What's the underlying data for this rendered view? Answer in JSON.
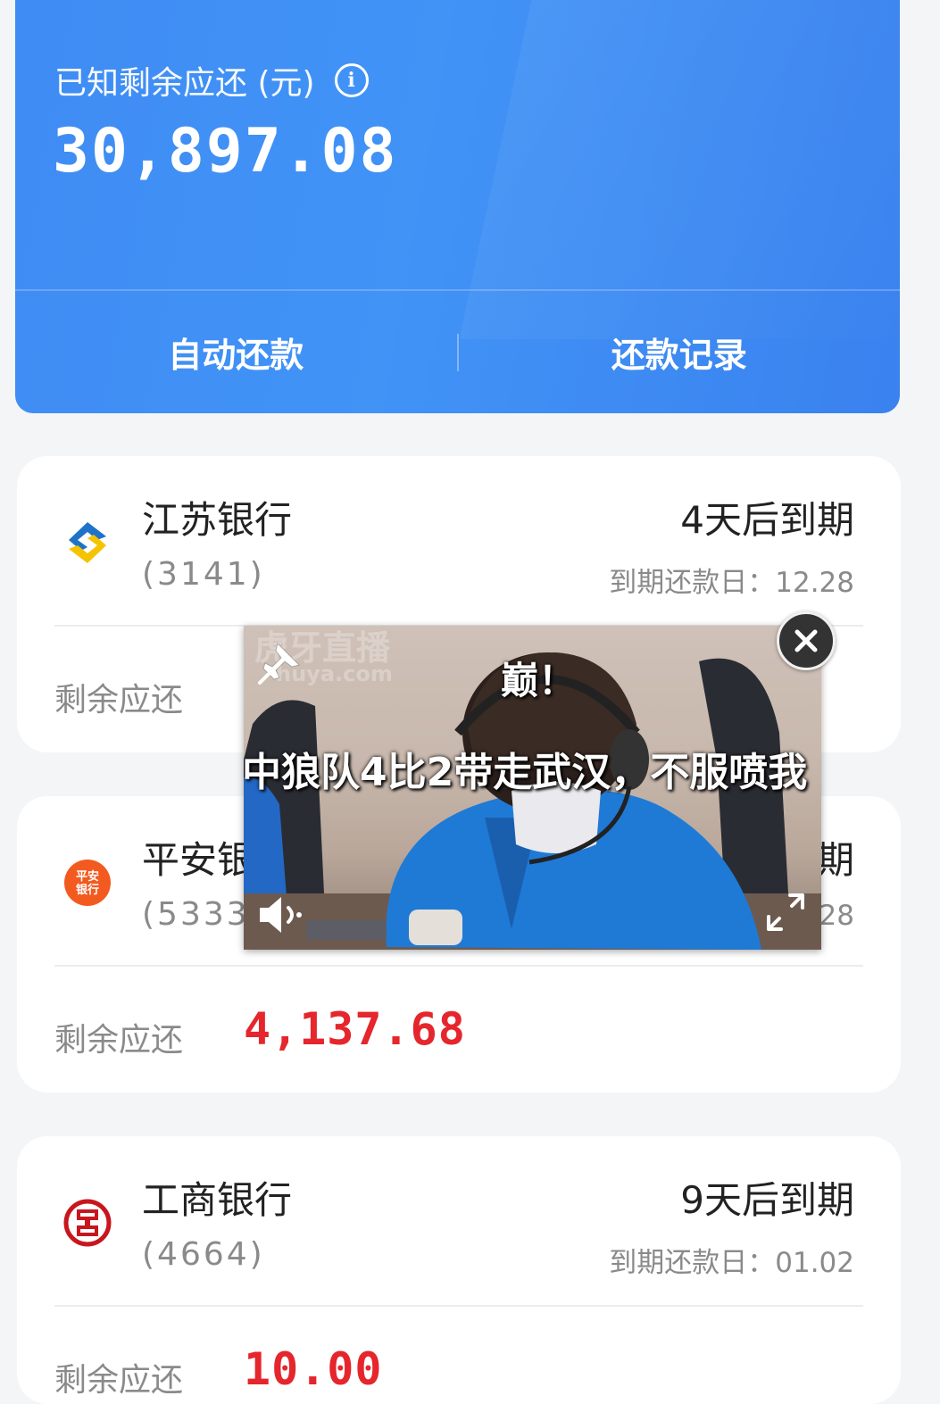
{
  "summary": {
    "label": "已知剩余应还 (元)",
    "amount": "30,897.08",
    "actions": [
      "自动还款",
      "还款记录"
    ]
  },
  "remaining_label": "剩余应还",
  "cards": [
    {
      "bank": "江苏银行",
      "tail": "(3141)",
      "due_in": "4天后到期",
      "due_date": "到期还款日：12.28",
      "remaining": "",
      "logo": "bank-of-jiangsu-logo",
      "logo_color": "#1e73c8"
    },
    {
      "bank": "平安银行",
      "tail": "(5333)",
      "due_in": "期",
      "due_date": "28",
      "remaining": "4,137.68",
      "logo": "ping-an-bank-logo",
      "logo_color": "#f25a1f"
    },
    {
      "bank": "工商银行",
      "tail": "(4664)",
      "due_in": "9天后到期",
      "due_date": "到期还款日：01.02",
      "remaining": "10.00",
      "logo": "icbc-logo",
      "logo_color": "#c8161d"
    }
  ],
  "video": {
    "watermark": "虎牙直播",
    "watermark_sub": "huya.com",
    "caption_top": "巅！",
    "caption_main": "中狼队4比2带走武汉，不服喷我",
    "icons": [
      "pin-icon",
      "volume-icon",
      "expand-icon",
      "close-icon"
    ]
  },
  "colors": {
    "primary_blue": "#3f8cf4",
    "amount_red": "#e5262c",
    "background": "#f4f5f7"
  }
}
